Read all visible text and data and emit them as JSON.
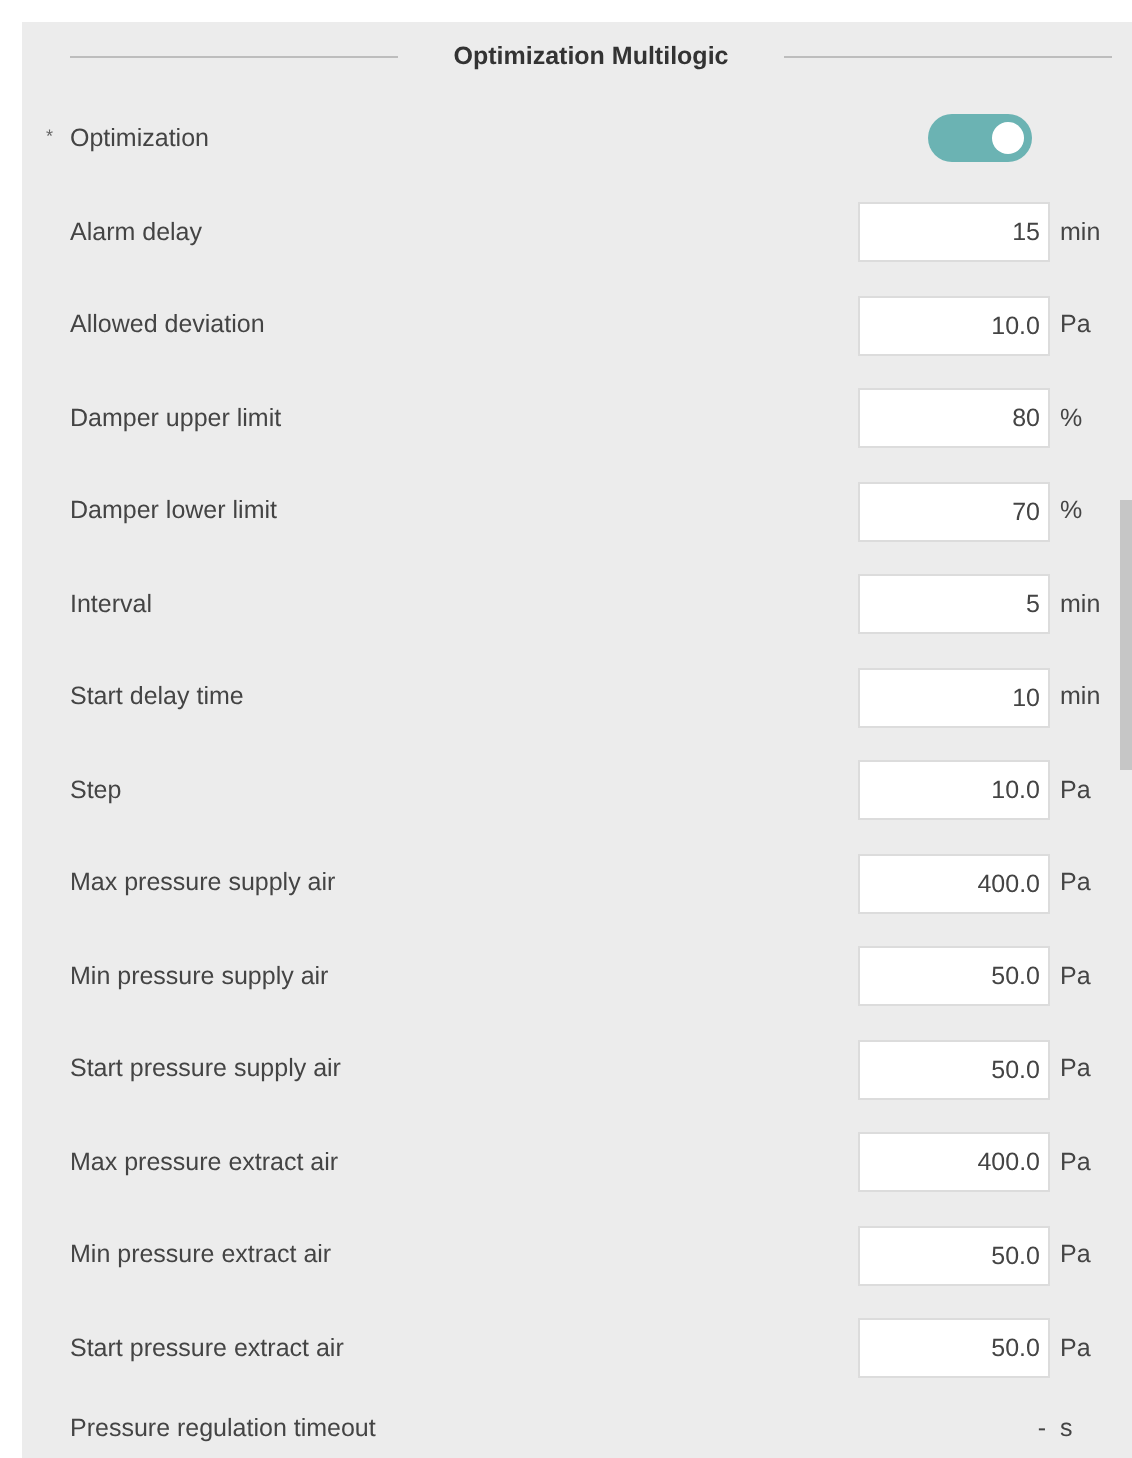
{
  "section_title": "Optimization Multilogic",
  "toggle": {
    "label": "Optimization",
    "required_mark": "*",
    "on": true
  },
  "fields": [
    {
      "kind": "input",
      "label": "Alarm delay",
      "value": "15",
      "unit": "min"
    },
    {
      "kind": "input",
      "label": "Allowed deviation",
      "value": "10.0",
      "unit": "Pa"
    },
    {
      "kind": "input",
      "label": "Damper upper limit",
      "value": "80",
      "unit": "%"
    },
    {
      "kind": "input",
      "label": "Damper lower limit",
      "value": "70",
      "unit": "%"
    },
    {
      "kind": "input",
      "label": "Interval",
      "value": "5",
      "unit": "min"
    },
    {
      "kind": "input",
      "label": "Start delay time",
      "value": "10",
      "unit": "min"
    },
    {
      "kind": "input",
      "label": "Step",
      "value": "10.0",
      "unit": "Pa"
    },
    {
      "kind": "input",
      "label": "Max pressure supply air",
      "value": "400.0",
      "unit": "Pa"
    },
    {
      "kind": "input",
      "label": "Min pressure supply air",
      "value": "50.0",
      "unit": "Pa"
    },
    {
      "kind": "input",
      "label": "Start pressure supply air",
      "value": "50.0",
      "unit": "Pa"
    },
    {
      "kind": "input",
      "label": "Max pressure extract air",
      "value": "400.0",
      "unit": "Pa"
    },
    {
      "kind": "input",
      "label": "Min pressure extract air",
      "value": "50.0",
      "unit": "Pa"
    },
    {
      "kind": "input",
      "label": "Start pressure extract air",
      "value": "50.0",
      "unit": "Pa"
    },
    {
      "kind": "readonly",
      "label": "Pressure regulation timeout",
      "value": "-",
      "unit": "s"
    }
  ]
}
